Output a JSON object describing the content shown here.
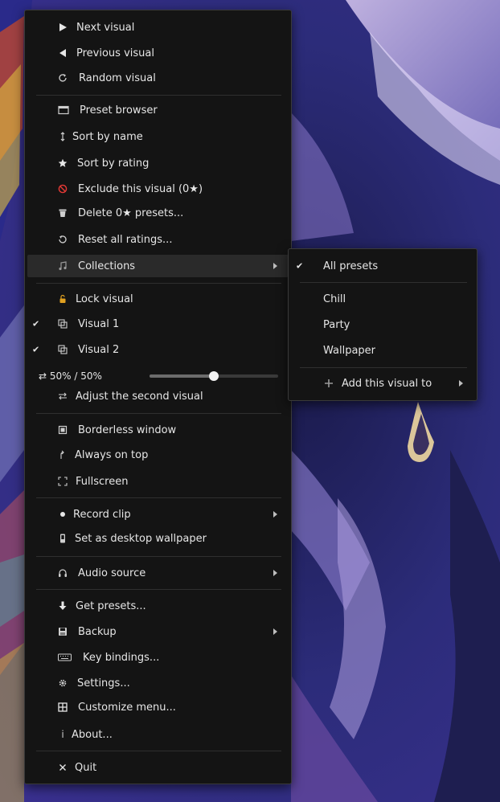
{
  "menu": {
    "next_visual": "Next visual",
    "previous_visual": "Previous visual",
    "random_visual": "Random visual",
    "preset_browser": "Preset browser",
    "sort_by_name": "Sort by name",
    "sort_by_rating": "Sort by rating",
    "exclude_visual": "Exclude this visual (0★)",
    "delete_presets": "Delete 0★ presets...",
    "reset_ratings": "Reset all ratings...",
    "collections": "Collections",
    "lock_visual": "Lock visual",
    "visual_1": "Visual 1",
    "visual_2": "Visual 2",
    "mix": {
      "label": "⇄ 50%  /  50%",
      "value": 0.5
    },
    "adjust_second": "Adjust the second visual",
    "borderless": "Borderless window",
    "always_on_top": "Always on top",
    "fullscreen": "Fullscreen",
    "record_clip": "Record clip",
    "desktop_wallpaper": "Set as desktop wallpaper",
    "audio_source": "Audio source",
    "get_presets": "Get presets...",
    "backup": "Backup",
    "key_bindings": "Key bindings...",
    "settings": "Settings...",
    "customize_menu": "Customize menu...",
    "about": "About...",
    "quit": "Quit",
    "checked": [
      "visual_1",
      "visual_2"
    ],
    "highlighted": "collections"
  },
  "collections_submenu": {
    "all_presets": "All presets",
    "chill": "Chill",
    "party": "Party",
    "wallpaper": "Wallpaper",
    "add_visual_to": "Add this visual to",
    "checked": [
      "all_presets"
    ]
  },
  "icons": {
    "next_visual": "play-icon",
    "previous_visual": "rewind-icon",
    "random_visual": "refresh-icon",
    "preset_browser": "window-icon",
    "sort_by_name": "sort-icon",
    "sort_by_rating": "star-icon",
    "exclude_visual": "prohibited-icon",
    "delete_presets": "trash-icon",
    "reset_ratings": "reset-icon",
    "collections": "music-note-icon",
    "lock_visual": "lock-icon",
    "visual_1": "layers-icon",
    "visual_2": "layers-icon",
    "adjust_second": "swap-icon",
    "borderless": "square-icon",
    "always_on_top": "pin-icon",
    "fullscreen": "fullscreen-icon",
    "record_clip": "record-icon",
    "desktop_wallpaper": "desktop-icon",
    "audio_source": "headphones-icon",
    "get_presets": "download-icon",
    "backup": "disk-icon",
    "key_bindings": "keyboard-icon",
    "settings": "gear-icon",
    "customize_menu": "grid-icon",
    "about": "info-icon",
    "quit": "close-icon",
    "add_visual_to": "plus-icon"
  },
  "colors": {
    "menu_bg": "#141414",
    "highlight": "#2a2a2a",
    "text": "#e6e6e6",
    "exclude_icon": "#e53935"
  }
}
